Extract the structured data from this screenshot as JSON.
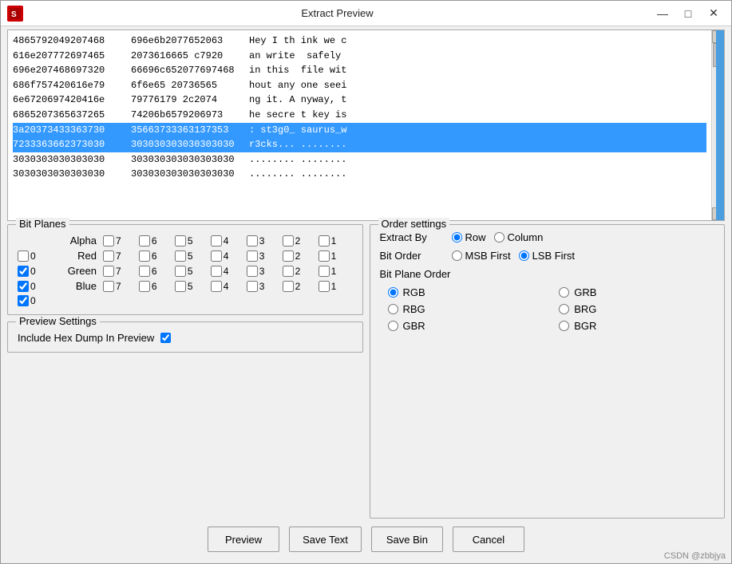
{
  "window": {
    "title": "Extract Preview",
    "app_icon": "S"
  },
  "titlebar": {
    "minimize_label": "—",
    "maximize_label": "□",
    "close_label": "✕"
  },
  "preview": {
    "lines": [
      {
        "hex1": "4865792049207468",
        "hex2": "696e6b2077652063",
        "text": "Hey I th ink we c",
        "highlight": false
      },
      {
        "hex1": "616e207772697465",
        "hex2": "2073616665 c7920",
        "text": "an write  safely",
        "highlight": false
      },
      {
        "hex1": "696e207468697320",
        "hex2": "66696c652077697468",
        "text": "in this  file wit",
        "highlight": false
      },
      {
        "hex1": "686f757420616e79",
        "hex2": "6f6e65 20736565",
        "text": "hout any one seei",
        "highlight": false
      },
      {
        "hex1": "6e6720697420416e",
        "hex2": "79776179 2c2074",
        "text": "ng it. A nyway, t",
        "highlight": false
      },
      {
        "hex1": "6865207365637265",
        "hex2": "74206b6579206973",
        "text": "he secre t key is",
        "highlight": false
      },
      {
        "hex1": "3a20373433363730",
        "hex2": "35663733363137353",
        "text": ": st3g0_ saurus_w",
        "highlight": true
      },
      {
        "hex1": "7233363662373030",
        "hex2": "303030303030303030",
        "text": "r3cks... ........",
        "highlight": true
      },
      {
        "hex1": "3030303030303030",
        "hex2": "303030303030303030",
        "text": "........ ........",
        "highlight": false
      },
      {
        "hex1": "3030303030303030",
        "hex2": "303030303030303030",
        "text": "........ ........",
        "highlight": false
      }
    ]
  },
  "bit_planes": {
    "title": "Bit Planes",
    "rows": [
      {
        "label": "Alpha",
        "bits": [
          {
            "num": 7,
            "checked": false
          },
          {
            "num": 6,
            "checked": false
          },
          {
            "num": 5,
            "checked": false
          },
          {
            "num": 4,
            "checked": false
          },
          {
            "num": 3,
            "checked": false
          },
          {
            "num": 2,
            "checked": false
          },
          {
            "num": 1,
            "checked": false
          },
          {
            "num": 0,
            "checked": false
          }
        ]
      },
      {
        "label": "Red",
        "bits": [
          {
            "num": 7,
            "checked": false
          },
          {
            "num": 6,
            "checked": false
          },
          {
            "num": 5,
            "checked": false
          },
          {
            "num": 4,
            "checked": false
          },
          {
            "num": 3,
            "checked": false
          },
          {
            "num": 2,
            "checked": false
          },
          {
            "num": 1,
            "checked": false
          },
          {
            "num": 0,
            "checked": true
          }
        ]
      },
      {
        "label": "Green",
        "bits": [
          {
            "num": 7,
            "checked": false
          },
          {
            "num": 6,
            "checked": false
          },
          {
            "num": 5,
            "checked": false
          },
          {
            "num": 4,
            "checked": false
          },
          {
            "num": 3,
            "checked": false
          },
          {
            "num": 2,
            "checked": false
          },
          {
            "num": 1,
            "checked": false
          },
          {
            "num": 0,
            "checked": true
          }
        ]
      },
      {
        "label": "Blue",
        "bits": [
          {
            "num": 7,
            "checked": false
          },
          {
            "num": 6,
            "checked": false
          },
          {
            "num": 5,
            "checked": false
          },
          {
            "num": 4,
            "checked": false
          },
          {
            "num": 3,
            "checked": false
          },
          {
            "num": 2,
            "checked": false
          },
          {
            "num": 1,
            "checked": false
          },
          {
            "num": 0,
            "checked": true
          }
        ]
      }
    ]
  },
  "preview_settings": {
    "title": "Preview Settings",
    "hex_dump_label": "Include Hex Dump In Preview",
    "hex_dump_checked": true
  },
  "order_settings": {
    "title": "Order settings",
    "extract_by_label": "Extract By",
    "row_label": "Row",
    "column_label": "Column",
    "row_selected": true,
    "bit_order_label": "Bit Order",
    "msb_first_label": "MSB First",
    "lsb_first_label": "LSB First",
    "lsb_selected": true,
    "bit_plane_order_title": "Bit Plane Order",
    "options": [
      {
        "label": "RGB",
        "selected": true
      },
      {
        "label": "GRB",
        "selected": false
      },
      {
        "label": "RBG",
        "selected": false
      },
      {
        "label": "BRG",
        "selected": false
      },
      {
        "label": "GBR",
        "selected": false
      },
      {
        "label": "BGR",
        "selected": false
      }
    ]
  },
  "buttons": {
    "preview": "Preview",
    "save_text": "Save Text",
    "save_bin": "Save Bin",
    "cancel": "Cancel"
  },
  "watermark": "CSDN @zbbjya"
}
